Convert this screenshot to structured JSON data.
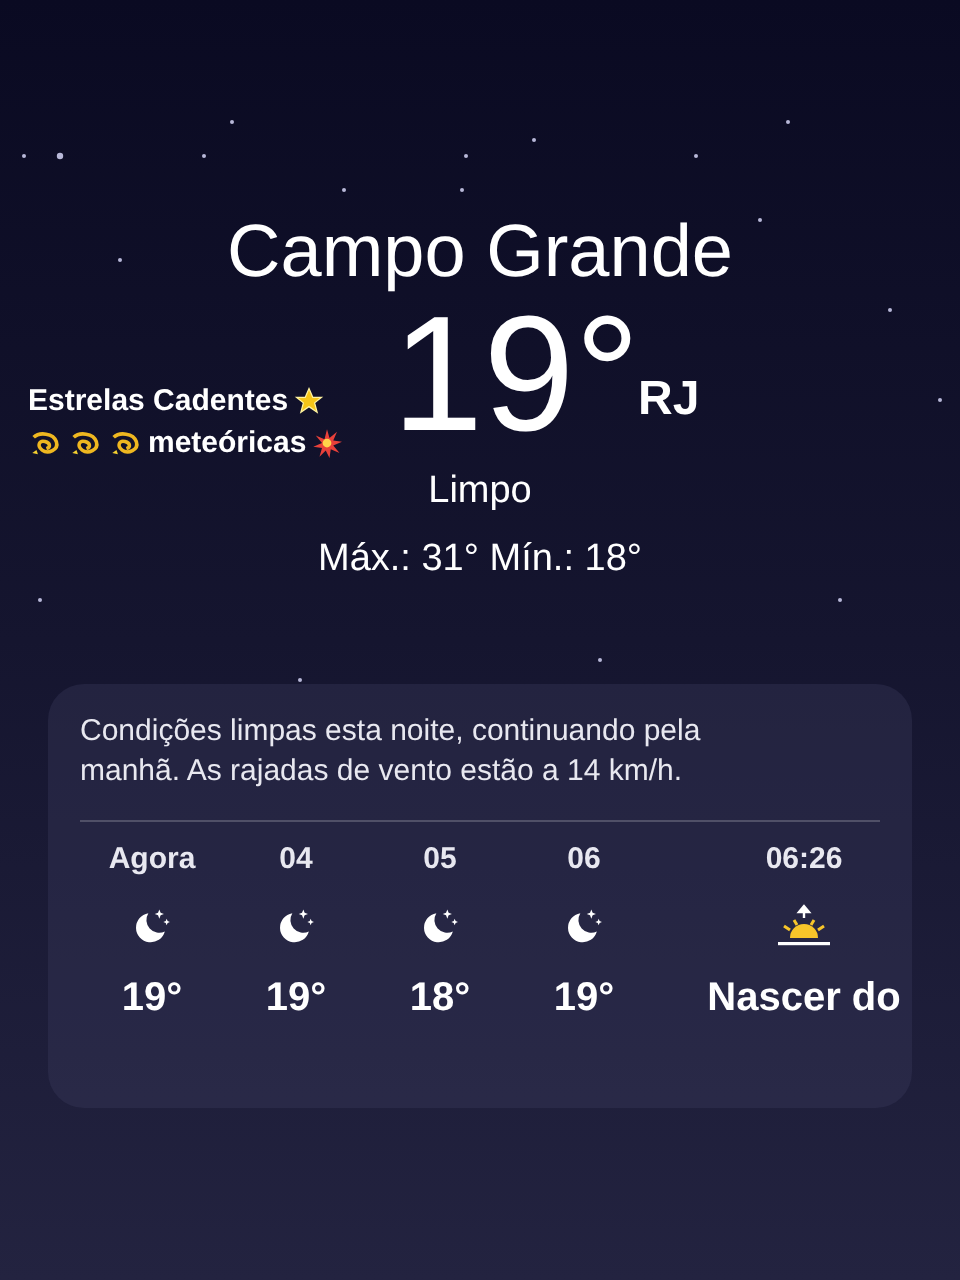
{
  "city": "Campo Grande",
  "temperature": "19°",
  "condition": "Limpo",
  "high_low": "Máx.: 31°  Mín.: 18°",
  "stickers": [
    {
      "kind": "caption",
      "lines": [
        "Estrelas Cadentes",
        "meteóricas"
      ]
    },
    {
      "kind": "tag",
      "text": "RJ"
    }
  ],
  "forecast": {
    "summary": "Condições limpas esta noite, continuando pela manhã. As rajadas de vento estão a 14 km/h.",
    "hours": [
      {
        "kind": "night",
        "time": "Agora",
        "value": "19°"
      },
      {
        "kind": "night",
        "time": "04",
        "value": "19°"
      },
      {
        "kind": "night",
        "time": "05",
        "value": "18°"
      },
      {
        "kind": "night",
        "time": "06",
        "value": "19°"
      },
      {
        "kind": "sunrise",
        "time": "06:26",
        "value": "Nascer do"
      }
    ]
  }
}
